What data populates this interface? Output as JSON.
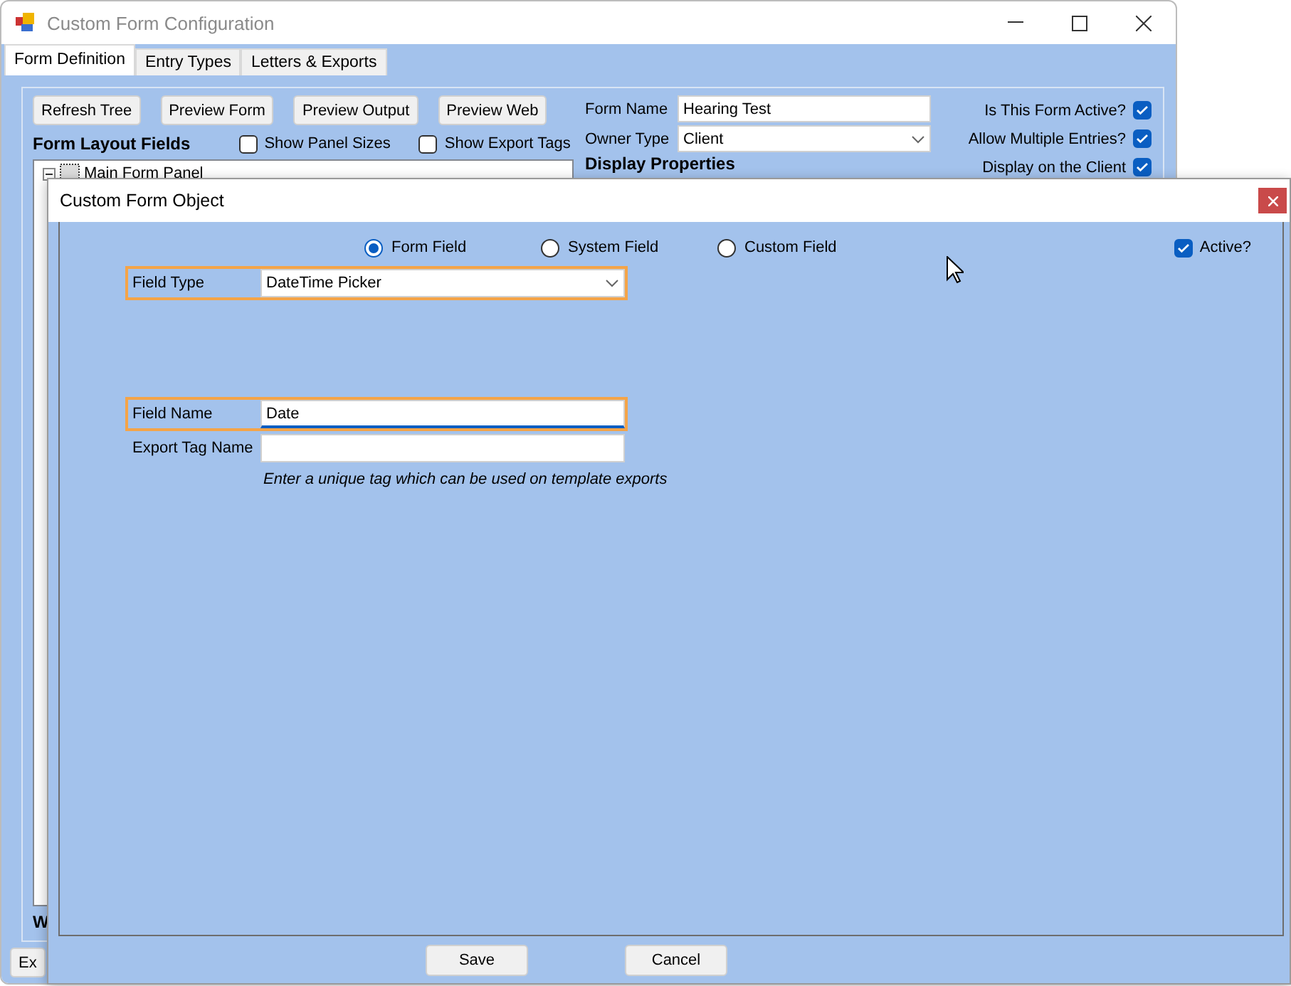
{
  "main_window": {
    "title": "Custom Form Configuration",
    "tabs": [
      {
        "label": "Form Definition",
        "selected": true
      },
      {
        "label": "Entry Types",
        "selected": false
      },
      {
        "label": "Letters & Exports",
        "selected": false
      }
    ],
    "toolbar_buttons": [
      "Refresh Tree",
      "Preview Form",
      "Preview Output",
      "Preview Web"
    ],
    "layout_heading": "Form Layout Fields",
    "view_options": [
      {
        "label": "Show Panel Sizes",
        "checked": false
      },
      {
        "label": "Show Export Tags",
        "checked": false
      }
    ],
    "tree": [
      {
        "label": "Main Form Panel",
        "expanded": true
      }
    ],
    "form_name": {
      "label": "Form Name",
      "value": "Hearing Test"
    },
    "owner_type": {
      "label": "Owner Type",
      "value": "Client"
    },
    "section_heading": "Display Properties",
    "flags": [
      {
        "label": "Is This Form Active?",
        "checked": true
      },
      {
        "label": "Allow Multiple Entries?",
        "checked": true
      },
      {
        "label": "Display on the Client",
        "checked": true
      }
    ],
    "bottom_label": "W",
    "bottom_button": "Ex"
  },
  "dialog": {
    "title": "Custom Form Object",
    "source_options": [
      {
        "label": "Form Field",
        "selected": true
      },
      {
        "label": "System Field",
        "selected": false
      },
      {
        "label": "Custom Field",
        "selected": false
      }
    ],
    "active": {
      "label": "Active?",
      "checked": true
    },
    "field_type": {
      "label": "Field Type",
      "value": "DateTime Picker",
      "highlighted": true
    },
    "field_name": {
      "label": "Field Name",
      "value": "Date",
      "highlighted": true,
      "focused": true
    },
    "export_tag": {
      "label": "Export Tag Name",
      "help_text": "Enter a unique tag which can be used on template exports"
    },
    "buttons": [
      "Save",
      "Cancel"
    ]
  }
}
